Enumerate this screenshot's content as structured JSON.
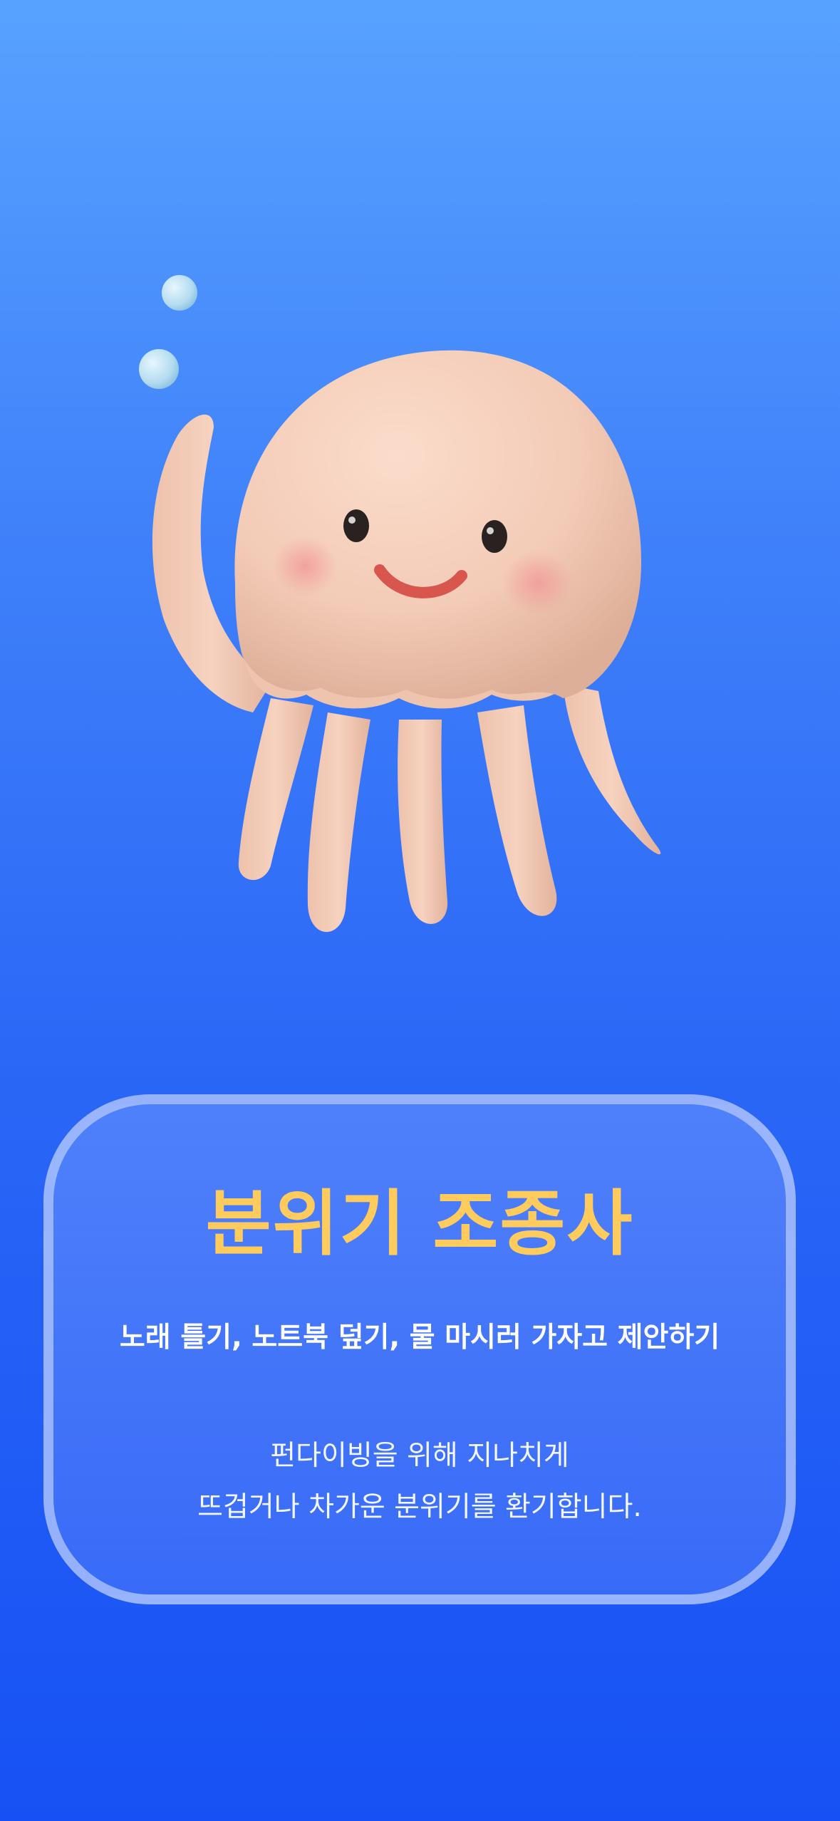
{
  "card": {
    "title": "분위기 조종사",
    "subtitle": "노래 틀기, 노트북 덮기, 물 마시러 가자고 제안하기",
    "description_lines": [
      "펀다이빙을 위해 지나치게",
      "뜨겁거나 차가운 분위기를 환기합니다."
    ]
  },
  "colors": {
    "background_top": "#58A2FF",
    "background_bottom": "#1751F5",
    "title": "#FFCB5C",
    "mascot_body": "#F3CDB8",
    "bubble": "#BFE3F5"
  },
  "illustration": {
    "subject": "jellyfish-mascot-icon",
    "bubbles": 2
  }
}
